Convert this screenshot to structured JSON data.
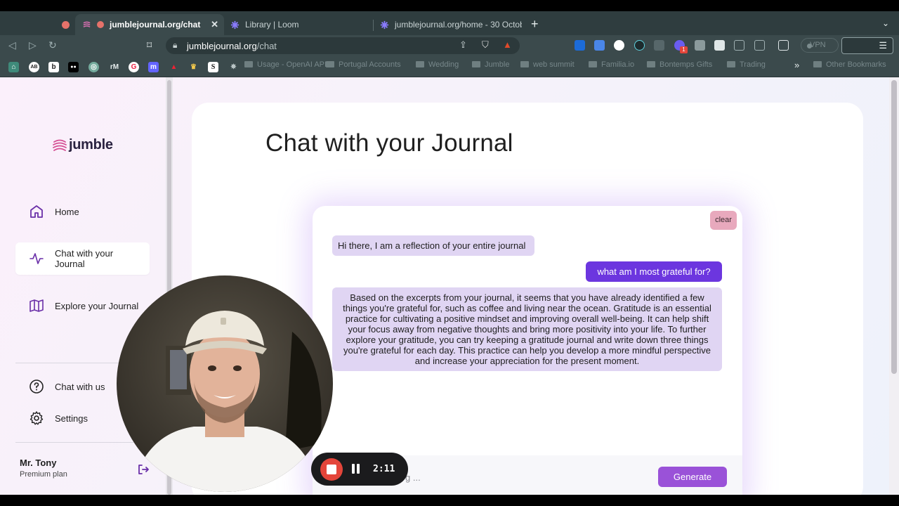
{
  "browser": {
    "tabs": [
      {
        "label": "",
        "favicon_color": "#e5726a"
      },
      {
        "label": "jumblejournal.org/chat",
        "active": true
      },
      {
        "label": "Library | Loom"
      },
      {
        "label": "jumblejournal.org/home - 30 Octob"
      }
    ],
    "url_host": "jumblejournal.org",
    "url_path": "/chat",
    "vpn_label": "VPN",
    "extension_badge": "1",
    "bookmarks": [
      "Usage - OpenAI API",
      "Portugal Accounts",
      "Wedding",
      "Jumble",
      "web summit",
      "Familia.io",
      "Bontemps Gifts",
      "Trading",
      "Other Bookmarks"
    ],
    "bookmark_icons": [
      "⌂",
      "AB",
      "b",
      "●●",
      "◎",
      "rM",
      "G",
      "m",
      "▲",
      "♛",
      "S",
      "✸"
    ]
  },
  "app": {
    "logo_text": "jumble",
    "nav": {
      "home": "Home",
      "chat": "Chat with your Journal",
      "explore": "Explore your Journal",
      "chat_with_us": "Chat with us",
      "settings": "Settings"
    },
    "user": {
      "name": "Mr. Tony",
      "plan": "Premium plan"
    },
    "page_title": "Chat with your Journal",
    "chat": {
      "clear_label": "clear",
      "messages": {
        "greeting": "Hi there, I am a reflection of your entire journal",
        "question": "what am I most grateful for?",
        "answer": "Based on the excerpts from your journal, it seems that you have already identified a few things you're grateful for, such as coffee and living near the ocean. Gratitude is an essential practice for cultivating a positive mindset and improving overall well-being. It can help shift your focus away from negative thoughts and bring more positivity into your life. To further explore your gratitude, you can try keeping a gratitude journal and write down three things you're grateful for each day. This practice can help you develop a more mindful perspective and increase your appreciation for the present moment."
      },
      "input_placeholder_visible": "g ...",
      "generate_label": "Generate"
    }
  },
  "recorder": {
    "time": "2:11"
  },
  "colors": {
    "accent": "#6c36df",
    "bubble": "#e0d5f3",
    "generate": "#9a52d8",
    "clear": "#e8a9bd",
    "record": "#e4453a"
  }
}
